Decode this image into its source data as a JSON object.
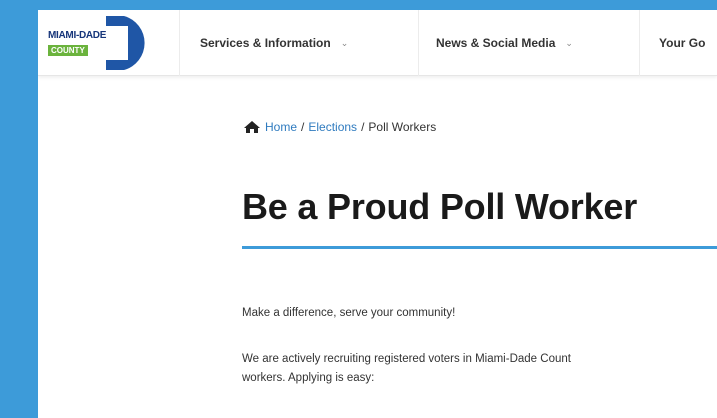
{
  "logo": {
    "line1": "MIAMI-DADE",
    "line2": "COUNTY"
  },
  "nav": {
    "items": [
      {
        "label": "Services & Information"
      },
      {
        "label": "News & Social Media"
      },
      {
        "label": "Your Go"
      }
    ]
  },
  "breadcrumb": {
    "home": "Home",
    "elections": "Elections",
    "current": "Poll Workers",
    "separator": "/"
  },
  "title": "Be a Proud Poll Worker",
  "body": {
    "p1": "Make a difference, serve your community!",
    "p2_line1": "We are actively recruiting registered voters in Miami-Dade Count",
    "p2_line2": "workers. Applying is easy:"
  },
  "colors": {
    "accent": "#3d9bd9",
    "link": "#2f7bbf",
    "logo_navy": "#16357a",
    "logo_green": "#6bb33d"
  }
}
